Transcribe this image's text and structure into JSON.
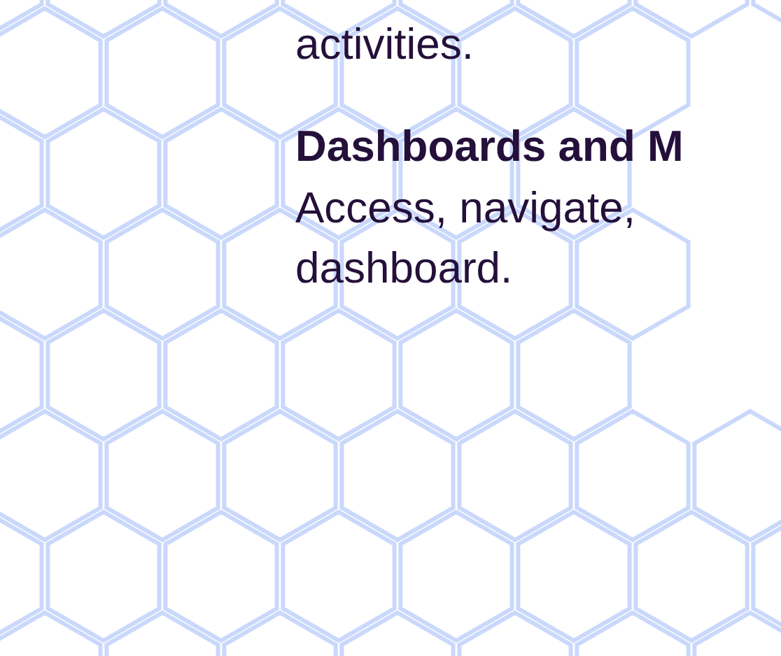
{
  "sections": [
    {
      "kind": "continuation",
      "lines": [
        "activities."
      ]
    },
    {
      "kind": "feature",
      "heading": "Dashboards and M",
      "lines": [
        "Access, navigate,",
        "dashboard."
      ]
    }
  ]
}
